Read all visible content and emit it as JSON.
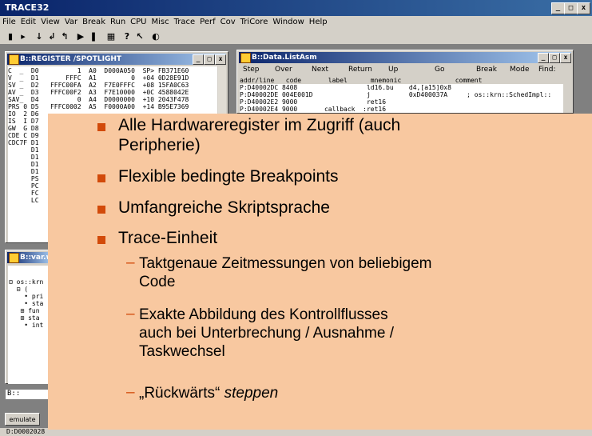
{
  "app": {
    "title": "TRACE32",
    "title_controls": [
      "_",
      "□",
      "x"
    ]
  },
  "menu": [
    "File",
    "Edit",
    "View",
    "Var",
    "Break",
    "Run",
    "CPU",
    "Misc",
    "Trace",
    "Perf",
    "Cov",
    "TriCore",
    "Window",
    "Help"
  ],
  "register_window": {
    "title": "B::REGISTER /SPOTLIGHT",
    "rows": [
      "C  _  D0          1  A0  D000A050  SP> FB371E60",
      "V  _  D1       FFFC  A1         0  +04 0D28E91D",
      "SV _  D2   FFFC00FA  A2  F7E0FFFC  +08 15FA0C63",
      "AV _  D3   FFFC00F2  A3  F7E10000  +0C 4588042E",
      "SAV_  D4          0  A4  D0000000  +10 2043F478",
      "PRS 0 D5   FFFC0002  A5  F0000A00  +14 B95E7369",
      "IO  2 D6",
      "IS  I D7",
      "GW  G D8",
      "CDE C D9",
      "CDC7F D1",
      "      D1",
      "      D1",
      "      D1",
      "      D1",
      "      PS",
      "      PC",
      "      FC",
      "      LC"
    ]
  },
  "list_window": {
    "title": "B::Data.ListAsm",
    "toolbar": [
      "Step",
      "Over",
      "Next",
      "Return",
      "Up",
      "Go",
      "Break",
      "Mode",
      "Find:"
    ],
    "header": "addr/line   code       label      mnemonic              comment",
    "rows": [
      "P:D40002DC 8408                  ld16.bu    d4,[a15]0x8",
      "P:D40002DE 004E001D              j          0xD400037A     ; os::krn::SchedImpl::",
      "P:D40002E2 9000                  ret16",
      "P:D40002E4 9000       callback  :ret16"
    ]
  },
  "var_window": {
    "title": "B::var.w",
    "lines": [
      "⊟ os::krn",
      "  ⊟ (",
      "    • pri",
      "    • sta",
      "   ⊞ fun",
      "   ⊞ sta",
      "    • int"
    ]
  },
  "command_line": {
    "prompt": "B::"
  },
  "emulate_button": "emulate",
  "status_bar": {
    "address": "D:D0002028"
  },
  "slide": {
    "bullets": [
      {
        "lines": [
          "Alle Hardwareregister im Zugriff (auch",
          "Peripherie)"
        ]
      },
      {
        "lines": [
          "Flexible bedingte Breakpoints"
        ]
      },
      {
        "lines": [
          "Umfangreiche Skriptsprache"
        ]
      },
      {
        "lines": [
          "Trace-Einheit"
        ]
      }
    ],
    "sub_bullets": [
      {
        "lines": [
          "Taktgenaue Zeitmessungen von beliebigem",
          "Code"
        ]
      },
      {
        "lines": [
          "Exakte Abbildung des Kontrollflusses",
          "auch bei Unterbrechung / Ausnahme /",
          "Taskwechsel"
        ]
      },
      {
        "prefix": "„Rückwärts“ ",
        "italic": "steppen"
      }
    ],
    "dash_glyph": "–"
  },
  "colors": {
    "bullet": "#d24a0a",
    "overlay": "#f8c8a0",
    "title_bar": "#0a246a"
  }
}
